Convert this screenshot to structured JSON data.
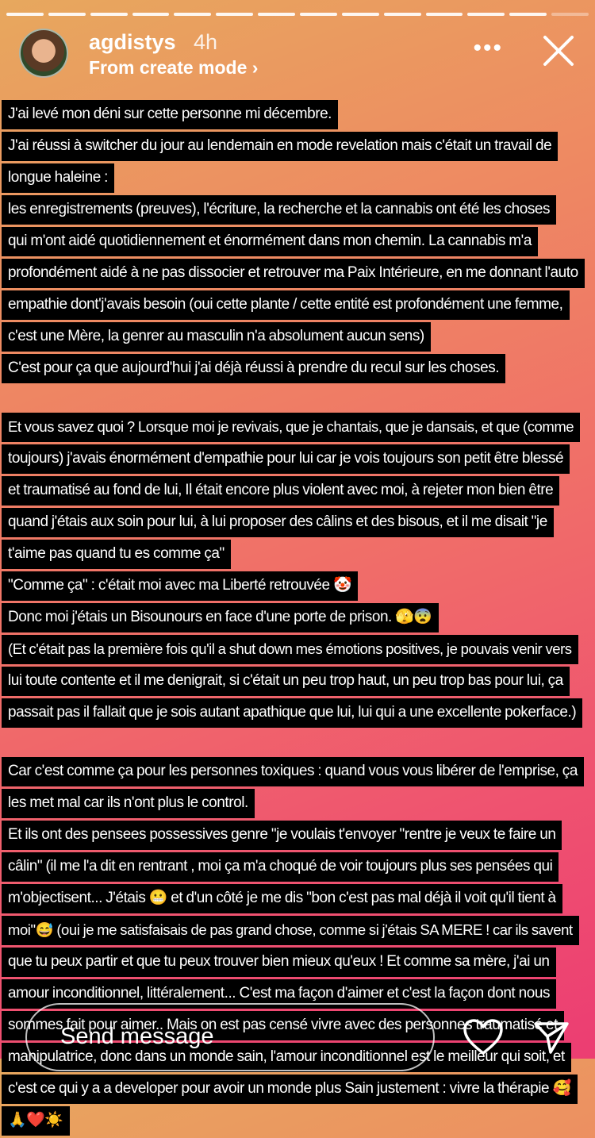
{
  "story": {
    "progress_total": 14,
    "progress_done": 13,
    "username": "agdistys",
    "time": "4h",
    "subtitle": "From create mode ›",
    "more_icon": "more-icon",
    "close_icon": "close-icon"
  },
  "lines": [
    "J'ai levé mon déni sur cette personne mi décembre.",
    "J'ai réussi à switcher du jour au lendemain en mode revelation mais c'était un travail de",
    "longue haleine :",
    "les enregistrements (preuves), l'écriture, la recherche et la cannabis ont été les choses",
    "qui m'ont aidé quotidiennement et énormément dans mon chemin. La cannabis  m'a",
    "profondément aidé à ne pas dissocier et retrouver ma Paix Intérieure, en me donnant l'auto",
    "empathie dont'j'avais besoin (oui cette plante / cette entité est profondément une femme,",
    "c'est une Mère, la genrer au masculin n'a absolument aucun sens)",
    "C'est pour ça que aujourd'hui j'ai déjà réussi à prendre du recul sur les choses.",
    "",
    "Et vous savez quoi ? Lorsque moi je revivais, que je chantais, que je dansais, et que (comme",
    "toujours) j'avais énormément d'empathie pour lui car je vois toujours son petit être blessé",
    "et traumatisé au fond de lui, Il était encore plus violent avec moi, à rejeter mon bien être",
    "quand j'étais aux soin pour lui, à lui proposer des câlins et des bisous, et il me disait \"je",
    "t'aime pas quand tu es comme ça\"",
    "\"Comme ça\" : c'était moi avec ma Liberté retrouvée 🤡",
    "Donc moi j'étais un Bisounours en face d'une porte de prison. 🫣😨",
    "(Et c'était pas la première fois qu'il a shut down mes émotions positives, je pouvais venir vers",
    "lui toute contente et il me denigrait, si c'était un peu trop haut, un peu trop bas pour lui, ça",
    "passait pas il fallait que je sois autant apathique que lui, lui qui a une excellente pokerface.)",
    "",
    "Car c'est comme ça pour les personnes toxiques : quand vous vous libérer de l'emprise, ça",
    "les met mal car ils n'ont plus le control.",
    "Et ils ont des pensees possessives genre \"je voulais t'envoyer \"rentre je veux te faire un",
    "câlin\" (il me l'a dit en rentrant , moi ça m'a choqué de voir toujours plus ses pensées qui",
    "m'objectisent... J'étais 😬 et d'un côté je me dis \"bon c'est pas mal déjà  il voit qu'il tient à",
    "moi\"😅 (oui je me satisfaisais de pas grand chose, comme si j'étais SA MERE ! car ils savent",
    "que tu peux partir et que tu peux trouver bien mieux qu'eux ! Et comme sa mère, j'ai un",
    "amour inconditionnel, littéralement... C'est ma façon d'aimer et c'est la façon dont nous",
    "sommes fait pour aimer.. Mais on est pas censé vivre avec des personnes traumatisé et",
    "manipulatrice, donc dans un monde sain, l'amour inconditionnel est le meilleur qui soit, et",
    "c'est ce qui y a a developer pour avoir un monde plus Sain justement : vivre la thérapie 🥰",
    "🙏❤️☀️"
  ],
  "footer": {
    "message_placeholder": "Send message",
    "heart_icon": "heart-icon",
    "send_icon": "send-icon"
  }
}
